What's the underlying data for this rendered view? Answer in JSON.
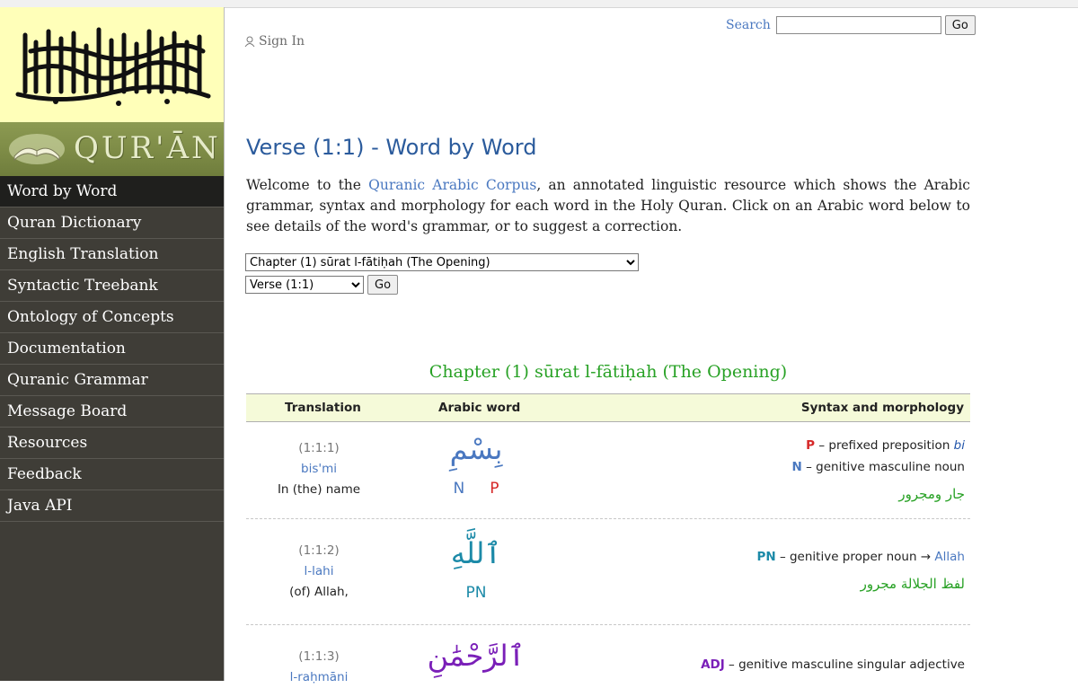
{
  "sidebar": {
    "brand_text": "QUR'ĀN",
    "nav": [
      {
        "label": "Word by Word",
        "active": true
      },
      {
        "label": "Quran Dictionary"
      },
      {
        "label": "English Translation"
      },
      {
        "label": "Syntactic Treebank"
      },
      {
        "label": "Ontology of Concepts"
      },
      {
        "label": "Documentation"
      },
      {
        "label": "Quranic Grammar"
      },
      {
        "label": "Message Board"
      },
      {
        "label": "Resources"
      },
      {
        "label": "Feedback"
      },
      {
        "label": "Java API"
      }
    ]
  },
  "header": {
    "signin_label": "Sign In",
    "search_label": "Search",
    "search_value": "",
    "search_button": "Go"
  },
  "page": {
    "title": "Verse (1:1) - Word by Word",
    "intro_before": "Welcome to the ",
    "intro_link": "Quranic Arabic Corpus",
    "intro_after": ", an annotated linguistic resource which shows the Arabic grammar, syntax and morphology for each word in the Holy Quran. Click on an Arabic word below to see details of the word's grammar, or to suggest a correction.",
    "chapter_select": "Chapter (1) sūrat l-fātiḥah (The Opening)",
    "verse_select": "Verse (1:1)",
    "go_button": "Go",
    "chapter_heading": "Chapter (1) sūrat l-fātiḥah (The Opening)"
  },
  "table": {
    "headers": {
      "translation": "Translation",
      "arabic": "Arabic word",
      "syntax": "Syntax and morphology"
    },
    "rows": [
      {
        "loc": "(1:1:1)",
        "translit": "bis'mi",
        "english": "In (the) name",
        "arabic": "بِسْمِ",
        "tags": [
          "N",
          "P"
        ],
        "syntax_1_tag": "P",
        "syntax_1_text": " – prefixed preposition ",
        "syntax_1_extra": "bi",
        "syntax_2_tag": "N",
        "syntax_2_text": " – genitive masculine noun",
        "arabic_grammar": "جار ومجرور"
      },
      {
        "loc": "(1:1:2)",
        "translit": "l-lahi",
        "english": "(of) Allah,",
        "arabic": "ٱللَّهِ",
        "tags": [
          "PN"
        ],
        "syntax_1_tag": "PN",
        "syntax_1_text": " – genitive proper noun → ",
        "syntax_1_extra": "Allah",
        "arabic_grammar": "لفظ الجلالة مجرور"
      },
      {
        "loc": "(1:1:3)",
        "translit": "l-raḥmāni",
        "english": "",
        "arabic": "ٱلرَّحْمَٰنِ",
        "syntax_1_tag": "ADJ",
        "syntax_1_text": " – genitive masculine singular adjective"
      }
    ]
  },
  "colors": {
    "title": "#2b5b9c",
    "link": "#4a78c0",
    "heading_green": "#27a124",
    "prep_red": "#d62828",
    "noun_blue": "#4a78c0",
    "pn_teal": "#1c8aa8",
    "adj_purple": "#7a1fb8"
  }
}
